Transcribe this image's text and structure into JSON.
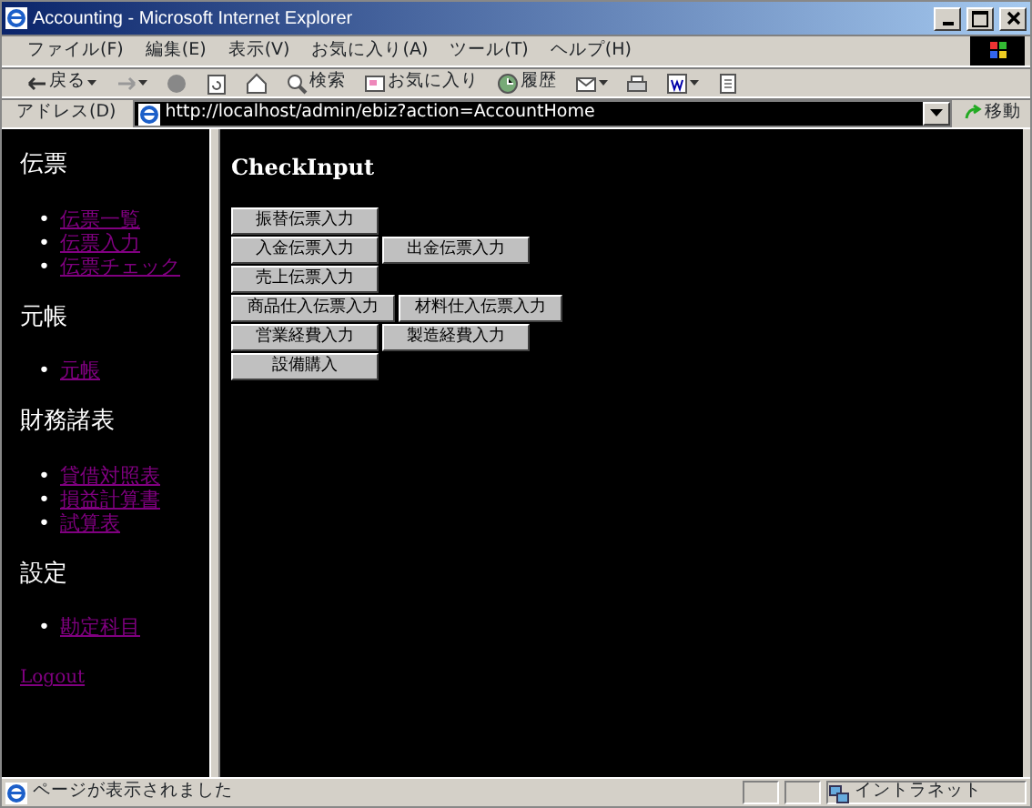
{
  "window": {
    "title": "Accounting - Microsoft Internet Explorer"
  },
  "menu": [
    "ファイル(F)",
    "編集(E)",
    "表示(V)",
    "お気に入り(A)",
    "ツール(T)",
    "ヘルプ(H)"
  ],
  "toolbar": [
    {
      "kind": "back",
      "label": "戻る"
    },
    {
      "kind": "forward"
    },
    {
      "kind": "stop"
    },
    {
      "kind": "refresh"
    },
    {
      "kind": "home"
    },
    {
      "kind": "search",
      "label": "検索"
    },
    {
      "kind": "favorites",
      "label": "お気に入り"
    },
    {
      "kind": "history",
      "label": "履歴"
    },
    {
      "kind": "mail"
    },
    {
      "kind": "print"
    },
    {
      "kind": "edit"
    },
    {
      "kind": "discuss"
    }
  ],
  "address": {
    "label": "アドレス(D)",
    "value": "http://localhost/admin/ebiz?action=AccountHome",
    "go": "移動"
  },
  "sidebar": {
    "sections": [
      {
        "title": "伝票",
        "links": [
          "伝票一覧",
          "伝票入力",
          "伝票チェック"
        ]
      },
      {
        "title": "元帳",
        "links": [
          "元帳"
        ]
      },
      {
        "title": "財務諸表",
        "links": [
          "貸借対照表",
          "損益計算書",
          "試算表"
        ]
      },
      {
        "title": "設定",
        "links": [
          "勘定科目"
        ]
      }
    ],
    "bullet": "•",
    "logout": "Logout"
  },
  "main": {
    "heading": "CheckInput",
    "button_rows": [
      [
        "振替伝票入力"
      ],
      [
        "入金伝票入力",
        "出金伝票入力"
      ],
      [
        "売上伝票入力"
      ],
      [
        "商品仕入伝票入力",
        "材料仕入伝票入力"
      ],
      [
        "営業経費入力",
        "製造経費入力"
      ],
      [
        "設備購入"
      ]
    ]
  },
  "status_bar": {
    "text": "ページが表示されました",
    "zone": "イントラネット"
  }
}
